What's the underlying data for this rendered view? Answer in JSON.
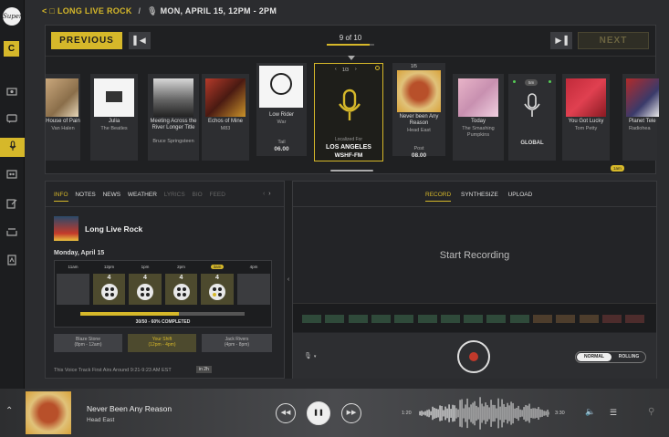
{
  "sidebar": {
    "logo": "Super",
    "c_label": "C",
    "items": [
      {
        "icon": "radio-icon"
      },
      {
        "icon": "chat-icon"
      },
      {
        "icon": "microphone-icon",
        "active": true
      },
      {
        "icon": "console-icon"
      },
      {
        "icon": "edit-icon"
      },
      {
        "icon": "layers-icon"
      },
      {
        "icon": "document-icon"
      }
    ]
  },
  "header": {
    "back": "<",
    "folder_glyph": "□",
    "show": "LONG LIVE ROCK",
    "sep": "/",
    "date": "MON, APRIL 15, 12PM - 2PM"
  },
  "carousel": {
    "previous": "PREVIOUS",
    "next": "NEXT",
    "counter": "9 of 10",
    "counter_progress": 0.9,
    "selected": {
      "pager": "1/3",
      "localized_label": "Localized For",
      "city": "LOS ANGELES",
      "station": "WSHF-FM"
    },
    "cards": [
      {
        "pill": "4m",
        "title": "House of Pain",
        "artist": "Van Halen"
      },
      {
        "pill": "5m",
        "title": "Julia",
        "artist": "The Beatles"
      },
      {
        "pill": "3m",
        "title": "Meeting Across the River Longer Title",
        "artist": "Bruce Springsteen"
      },
      {
        "pill": "3m",
        "title": "Echos of Mine",
        "artist": "M83"
      },
      {
        "title": "Low Rider",
        "artist": "War",
        "foot_label": "Tail",
        "foot_value": "06.00"
      },
      {
        "title": "Never been Any Reason",
        "artist": "Head East",
        "pager": "1/5",
        "foot_label": "Post",
        "foot_value": "08.00"
      },
      {
        "pill": "4m",
        "title": "Today",
        "artist": "The Smashing Pumpkins"
      },
      {
        "pill": "5m",
        "title": "GLOBAL",
        "artist": ""
      },
      {
        "pill": "12m",
        "title": "You Got Lucky",
        "artist": "Tom Petty"
      },
      {
        "pill": "4m",
        "title": "Planet Tele",
        "artist": "Radiohea"
      }
    ],
    "tag_1am": "1am"
  },
  "left_panel": {
    "tabs": [
      "INFO",
      "NOTES",
      "NEWS",
      "WEATHER",
      "LYRICS",
      "BIO",
      "FEED"
    ],
    "active_tab": "INFO",
    "show_title": "Long Live Rock",
    "date": "Monday, April 15",
    "schedule": [
      {
        "time": "11am",
        "count": ""
      },
      {
        "time": "12pm",
        "count": "4"
      },
      {
        "time": "1pm",
        "count": "4"
      },
      {
        "time": "2pm",
        "count": "4"
      },
      {
        "time": "3am",
        "count": "4",
        "active": true
      },
      {
        "time": "4pm",
        "count": ""
      }
    ],
    "progress_text": "30/50 - 60% COMPLETED",
    "progress": 0.6,
    "hosts": [
      {
        "name": "Blaze Stone",
        "time": "(8pm - 12am)"
      },
      {
        "name": "Your Shift",
        "time": "(12pm - 4pm)"
      },
      {
        "name": "Jack Rivers",
        "time": "(4pm - 8pm)"
      }
    ],
    "voice_track": "This Voice Track First Airs Around 9:21-9:23 AM EST",
    "voice_tag": "in 2h"
  },
  "right_panel": {
    "tabs": [
      "RECORD",
      "SYNTHESIZE",
      "UPLOAD"
    ],
    "active_tab": "RECORD",
    "start": "Start Recording",
    "toggle_on": "NORMAL",
    "toggle_off": "ROLLING",
    "meter_colors": [
      "#2f4a3a",
      "#2f4a3a",
      "#2f4a3a",
      "#2f4a3a",
      "#2f4a3a",
      "#2f4a3a",
      "#2f4a3a",
      "#2f4a3a",
      "#2f4a3a",
      "#2f4a3a",
      "#4d3d2c",
      "#4d3d2c",
      "#4d3d2c",
      "#4d2c2c",
      "#4d2c2c"
    ]
  },
  "player": {
    "title": "Never Been Any Reason",
    "artist": "Head East",
    "time_current": "1:20",
    "time_total": "3:30"
  }
}
